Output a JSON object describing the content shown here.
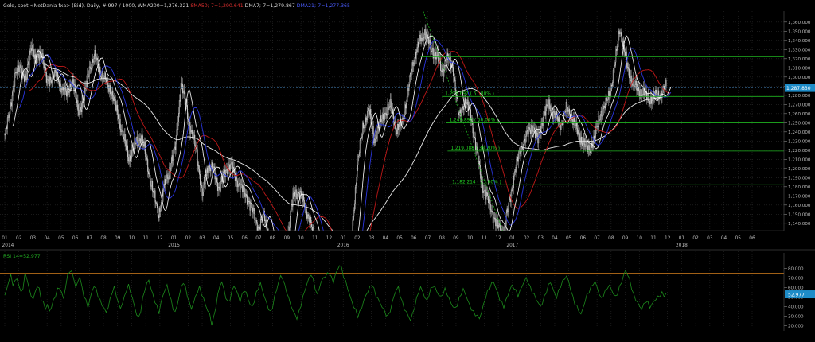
{
  "header": {
    "title_parts": [
      {
        "text": "Gold, spot <NetDania fxa> (Bid), Daily, # 997 / 1000, WMA200=1,276.321",
        "color": "#d8d8d8"
      },
      {
        "text": "SMA50;-7=1,290.641",
        "color": "#e03030"
      },
      {
        "text": "DMA7;-7=1,279.867",
        "color": "#d8d8d8"
      },
      {
        "text": "DMA21;-7=1,277.365",
        "color": "#4a5cff"
      }
    ]
  },
  "rsi_header": "RSI 14=52.977",
  "colors": {
    "background": "#000000",
    "grid": "#2a2a2a",
    "candle": "#cfcfcf",
    "wma200": "#e8e8e8",
    "sma50": "#c01818",
    "dma7": "#ffffff",
    "dma21": "#2a36e0",
    "fib": "#1fb21f",
    "fib_label": "#22d022",
    "rsi": "#1c8a1c",
    "rsi_upper": "#b86e1a",
    "rsi_lower": "#6a2a9a",
    "price_tag": "#1e8cc8"
  },
  "chart_data": [
    {
      "type": "candlestick",
      "symbol": "Gold, spot (Bid), Daily",
      "y_axis_ticks": [
        "1,360.000",
        "1,350.000",
        "1,340.000",
        "1,330.000",
        "1,320.000",
        "1,310.000",
        "1,300.000",
        "1,290.000",
        "1,280.000",
        "1,270.000",
        "1,260.000",
        "1,250.000",
        "1,240.000",
        "1,230.000",
        "1,220.000",
        "1,210.000",
        "1,200.000",
        "1,190.000",
        "1,180.000",
        "1,170.000",
        "1,160.000",
        "1,150.000",
        "1,140.000"
      ],
      "ylim": [
        1132,
        1372
      ],
      "x_month_ticks": [
        "01",
        "02",
        "03",
        "04",
        "05",
        "06",
        "07",
        "08",
        "09",
        "10",
        "11",
        "12",
        "01",
        "02",
        "03",
        "04",
        "05",
        "06",
        "07",
        "08",
        "09",
        "10",
        "11",
        "12",
        "01",
        "02",
        "03",
        "04",
        "05",
        "06",
        "07",
        "08",
        "09",
        "10",
        "11",
        "12",
        "01",
        "02",
        "03",
        "04",
        "05",
        "06",
        "07",
        "08",
        "09",
        "10",
        "11",
        "12",
        "01",
        "02",
        "03",
        "04",
        "05",
        "06"
      ],
      "x_year_labels": [
        {
          "label": "2014",
          "month_index": 0
        },
        {
          "label": "2015",
          "month_index": 12
        },
        {
          "label": "2016",
          "month_index": 24
        },
        {
          "label": "2017",
          "month_index": 36
        },
        {
          "label": "2018",
          "month_index": 48
        }
      ],
      "last_price": "1,287.830",
      "price_path": [
        [
          0,
          1235
        ],
        [
          0.3,
          1258
        ],
        [
          0.7,
          1300
        ],
        [
          1.1,
          1312
        ],
        [
          1.5,
          1295
        ],
        [
          1.9,
          1338
        ],
        [
          2.2,
          1315
        ],
        [
          2.6,
          1330
        ],
        [
          3.0,
          1292
        ],
        [
          3.5,
          1305
        ],
        [
          4.0,
          1290
        ],
        [
          4.4,
          1280
        ],
        [
          4.8,
          1298
        ],
        [
          5.2,
          1262
        ],
        [
          5.6,
          1275
        ],
        [
          6.0,
          1310
        ],
        [
          6.4,
          1322
        ],
        [
          6.8,
          1305
        ],
        [
          7.2,
          1295
        ],
        [
          7.6,
          1282
        ],
        [
          8.0,
          1260
        ],
        [
          8.4,
          1235
        ],
        [
          8.8,
          1210
        ],
        [
          9.2,
          1225
        ],
        [
          9.7,
          1235
        ],
        [
          10.1,
          1205
        ],
        [
          10.5,
          1175
        ],
        [
          10.9,
          1150
        ],
        [
          11.3,
          1180
        ],
        [
          11.7,
          1200
        ],
        [
          12.1,
          1222
        ],
        [
          12.5,
          1293
        ],
        [
          12.9,
          1265
        ],
        [
          13.2,
          1240
        ],
        [
          13.6,
          1220
        ],
        [
          14.0,
          1170
        ],
        [
          14.4,
          1205
        ],
        [
          14.8,
          1198
        ],
        [
          15.2,
          1178
        ],
        [
          15.6,
          1195
        ],
        [
          16.0,
          1205
        ],
        [
          16.4,
          1188
        ],
        [
          16.8,
          1178
        ],
        [
          17.2,
          1168
        ],
        [
          17.6,
          1152
        ],
        [
          18.0,
          1135
        ],
        [
          18.4,
          1150
        ],
        [
          18.7,
          1126
        ],
        [
          19.1,
          1110
        ],
        [
          19.5,
          1102
        ],
        [
          20.0,
          1118
        ],
        [
          20.5,
          1175
        ],
        [
          20.9,
          1172
        ],
        [
          21.3,
          1160
        ],
        [
          21.7,
          1138
        ],
        [
          22.1,
          1115
        ],
        [
          22.6,
          1076
        ],
        [
          23.0,
          1060
        ],
        [
          23.4,
          1075
        ],
        [
          23.8,
          1055
        ],
        [
          24.2,
          1082
        ],
        [
          24.6,
          1125
        ],
        [
          25.0,
          1205
        ],
        [
          25.4,
          1245
        ],
        [
          25.8,
          1265
        ],
        [
          26.2,
          1232
        ],
        [
          26.6,
          1248
        ],
        [
          27.0,
          1262
        ],
        [
          27.4,
          1268
        ],
        [
          27.8,
          1240
        ],
        [
          28.2,
          1252
        ],
        [
          28.6,
          1285
        ],
        [
          29.0,
          1320
        ],
        [
          29.4,
          1338
        ],
        [
          29.8,
          1350
        ],
        [
          30.2,
          1330
        ],
        [
          30.6,
          1325
        ],
        [
          31.0,
          1305
        ],
        [
          31.4,
          1320
        ],
        [
          31.8,
          1310
        ],
        [
          32.2,
          1255
        ],
        [
          32.6,
          1275
        ],
        [
          33.0,
          1262
        ],
        [
          33.4,
          1225
        ],
        [
          33.8,
          1185
        ],
        [
          34.2,
          1168
        ],
        [
          34.6,
          1150
        ],
        [
          35.0,
          1135
        ],
        [
          35.4,
          1132
        ],
        [
          35.8,
          1165
        ],
        [
          36.2,
          1200
        ],
        [
          36.6,
          1222
        ],
        [
          37.0,
          1235
        ],
        [
          37.4,
          1248
        ],
        [
          37.8,
          1230
        ],
        [
          38.2,
          1258
        ],
        [
          38.6,
          1270
        ],
        [
          39.0,
          1258
        ],
        [
          39.4,
          1248
        ],
        [
          39.8,
          1265
        ],
        [
          40.2,
          1258
        ],
        [
          40.6,
          1240
        ],
        [
          41.0,
          1228
        ],
        [
          41.4,
          1220
        ],
        [
          41.8,
          1232
        ],
        [
          42.2,
          1258
        ],
        [
          42.6,
          1268
        ],
        [
          43.0,
          1290
        ],
        [
          43.3,
          1318
        ],
        [
          43.6,
          1355
        ],
        [
          43.9,
          1330
        ],
        [
          44.2,
          1308
        ],
        [
          44.6,
          1290
        ],
        [
          45.0,
          1285
        ],
        [
          45.4,
          1280
        ],
        [
          45.8,
          1275
        ],
        [
          46.2,
          1280
        ],
        [
          46.6,
          1283
        ],
        [
          46.9,
          1290
        ]
      ],
      "annotations": [
        {
          "text": "1,278.697 ( 61.80% )",
          "price": 1278.697
        },
        {
          "text": "1,249.890 ( 50.00% )",
          "price": 1249.89
        },
        {
          "text": "1,219.088 ( 38.20% )",
          "price": 1219.088
        },
        {
          "text": "1,182.214 ( 23.60% )",
          "price": 1182.214
        }
      ],
      "fib_levels": [
        {
          "price": 1322.0,
          "x_from": 29.5
        },
        {
          "price": 1278.697,
          "x_from": 31.0
        },
        {
          "price": 1249.89,
          "x_from": 31.3
        },
        {
          "price": 1219.088,
          "x_from": 31.4
        },
        {
          "price": 1182.214,
          "x_from": 31.5
        }
      ],
      "fib_swing": {
        "from": [
          29.6,
          1375
        ],
        "to": [
          35.3,
          1132
        ]
      },
      "dashed_line_price": 1288
    },
    {
      "type": "line",
      "name": "RSI 14",
      "y_axis_ticks": [
        "80.000",
        "70.000",
        "60.000",
        "50.000",
        "40.000",
        "30.000",
        "20.000"
      ],
      "ylim": [
        18,
        88
      ],
      "last_value": "52.977",
      "upper_line": 75,
      "lower_line": 25,
      "mid_line": 50,
      "values": [
        52,
        58,
        68,
        72,
        64,
        66,
        70,
        62,
        55,
        60,
        74,
        70,
        58,
        52,
        48,
        55,
        62,
        58,
        48,
        44,
        38,
        42,
        35,
        40,
        46,
        52,
        58,
        60,
        55,
        48,
        62,
        72,
        78,
        76,
        70,
        60,
        66,
        72,
        60,
        52,
        46,
        40,
        48,
        56,
        62,
        58,
        52,
        46,
        42,
        38,
        34,
        40,
        48,
        56,
        60,
        52,
        44,
        38,
        44,
        50,
        58,
        62,
        56,
        48,
        40,
        32,
        28,
        36,
        48,
        58,
        64,
        68,
        60,
        52,
        46,
        40,
        34,
        44,
        52,
        58,
        62,
        54,
        46,
        38,
        34,
        42,
        52,
        60,
        66,
        60,
        52,
        44,
        38,
        44,
        50,
        56,
        60,
        54,
        48,
        42,
        36,
        32,
        22,
        28,
        40,
        52,
        62,
        66,
        58,
        50,
        44,
        48,
        56,
        62,
        58,
        52,
        46,
        52,
        58,
        54,
        48,
        42,
        40,
        46,
        54,
        60,
        64,
        58,
        50,
        44,
        38,
        34,
        40,
        50,
        58,
        66,
        72,
        70,
        62,
        56,
        48,
        42,
        36,
        32,
        28,
        34,
        42,
        50,
        58,
        64,
        70,
        74,
        68,
        60,
        52,
        60,
        66,
        70,
        72,
        74,
        76,
        70,
        66,
        74,
        78,
        84,
        80,
        72,
        66,
        60,
        52,
        46,
        40,
        36,
        30,
        34,
        40,
        46,
        52,
        56,
        60,
        64,
        58,
        52,
        48,
        44,
        40,
        36,
        32,
        30,
        36,
        44,
        52,
        58,
        60,
        52,
        44,
        38,
        34,
        30,
        26,
        32,
        40,
        48,
        56,
        60,
        56,
        50,
        46,
        52,
        58,
        62,
        60,
        56,
        52,
        50,
        54,
        58,
        54,
        48,
        44,
        40,
        38,
        42,
        48,
        54,
        58,
        54,
        48,
        42,
        38,
        34,
        32,
        30,
        28,
        34,
        42,
        50,
        56,
        60,
        64,
        66,
        60,
        54,
        48,
        44,
        40,
        46,
        52,
        58,
        62,
        60,
        56,
        52,
        56,
        62,
        66,
        70,
        66,
        60,
        56,
        52,
        48,
        44,
        40,
        44,
        50,
        56,
        62,
        66,
        60,
        54,
        50,
        56,
        62,
        66,
        70,
        72,
        66,
        58,
        50,
        44,
        40,
        36,
        32,
        38,
        46,
        52,
        56,
        60,
        64,
        66,
        60,
        54,
        48,
        52,
        56,
        60,
        62,
        58,
        54,
        50,
        54,
        60,
        66,
        72,
        78,
        74,
        68,
        60,
        52,
        48,
        44,
        40,
        38,
        42,
        46,
        44,
        40,
        42,
        46,
        48,
        50,
        52,
        54,
        52,
        53
      ]
    }
  ]
}
